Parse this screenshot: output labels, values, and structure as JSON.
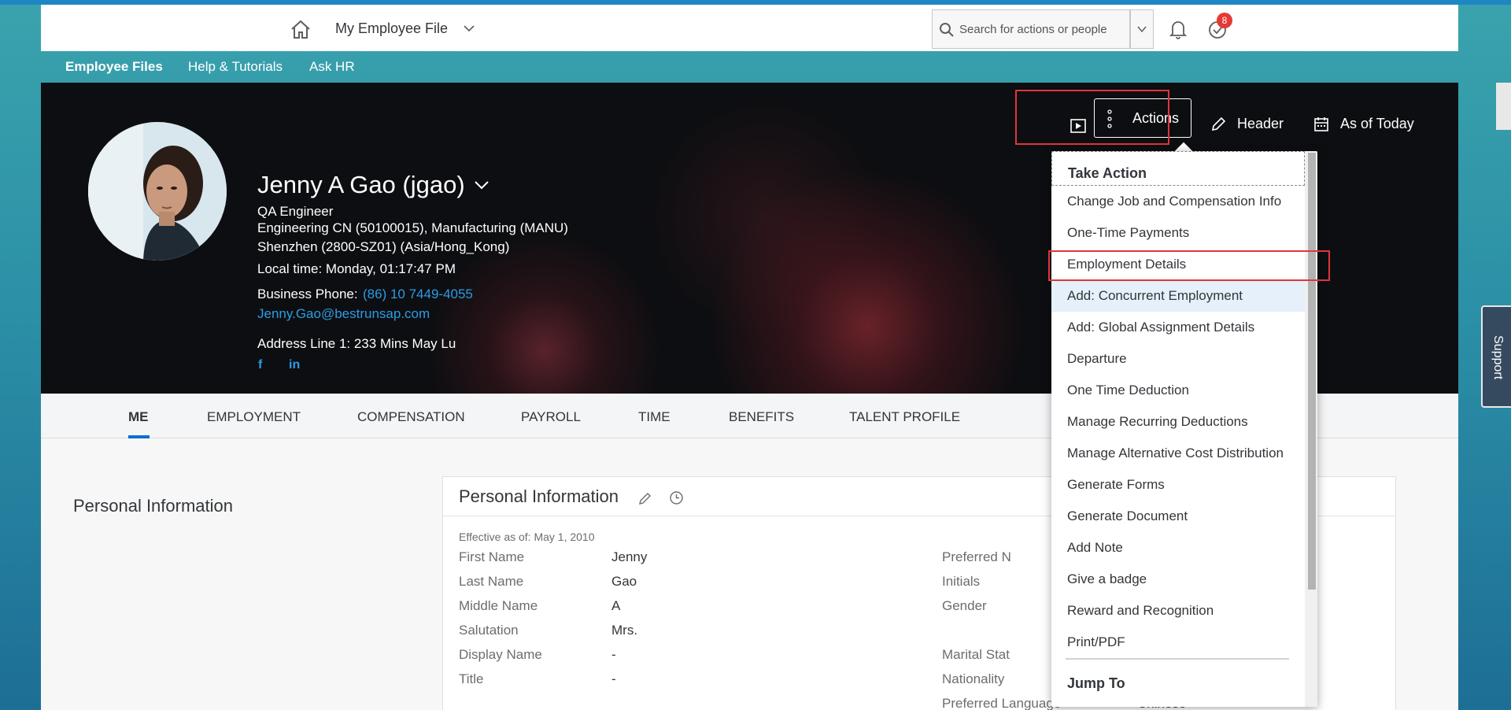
{
  "shell": {
    "title": "My Employee File",
    "search_placeholder": "Search for actions or people",
    "notification_count": "8"
  },
  "subnav": {
    "items": [
      "Employee Files",
      "Help & Tutorials",
      "Ask HR"
    ]
  },
  "header": {
    "name": "Jenny A Gao (jgao)",
    "job_title": "QA Engineer",
    "department": "Engineering CN (50100015), Manufacturing (MANU)",
    "location": "Shenzhen (2800-SZ01) (Asia/Hong_Kong)",
    "local_time": "Local time: Monday, 01:17:47 PM",
    "business_phone_label": "Business Phone:",
    "business_phone": "(86) 10 7449-4055",
    "email": "Jenny.Gao@bestrunsap.com",
    "address": "Address Line 1: 233 Mins May Lu",
    "social": [
      "f",
      "in"
    ],
    "actions_label": "Actions",
    "header_label": "Header",
    "as_of_label": "As of Today"
  },
  "tabs": [
    "ME",
    "EMPLOYMENT",
    "COMPENSATION",
    "PAYROLL",
    "TIME",
    "BENEFITS",
    "TALENT PROFILE"
  ],
  "content": {
    "section_label": "Personal Information",
    "card_title": "Personal Information",
    "effective": "Effective as of: May 1, 2010",
    "fields_left": [
      {
        "label": "First Name",
        "value": "Jenny"
      },
      {
        "label": "Last Name",
        "value": "Gao"
      },
      {
        "label": "Middle Name",
        "value": "A"
      },
      {
        "label": "Salutation",
        "value": "Mrs."
      },
      {
        "label": "Display Name",
        "value": "-"
      },
      {
        "label": "Title",
        "value": "-"
      }
    ],
    "fields_right": [
      {
        "label": "Preferred N",
        "value": ""
      },
      {
        "label": "Initials",
        "value": ""
      },
      {
        "label": "Gender",
        "value": ""
      },
      {
        "label": "Marital Stat",
        "value": ""
      },
      {
        "label": "Nationality",
        "value": ""
      },
      {
        "label": "Preferred Language",
        "value": "Chinese"
      }
    ]
  },
  "menu": {
    "take_action": "Take Action",
    "items": [
      "Change Job and Compensation Info",
      "One-Time Payments",
      "Employment Details",
      "Add: Concurrent Employment",
      "Add: Global Assignment Details",
      "Departure",
      "One Time Deduction",
      "Manage Recurring Deductions",
      "Manage Alternative Cost Distribution",
      "Generate Forms",
      "Generate Document",
      "Add Note",
      "Give a badge",
      "Reward and Recognition",
      "Print/PDF"
    ],
    "jump_to": "Jump To"
  },
  "support_label": "Support",
  "colors": {
    "accent": "#0a6ed1",
    "link": "#2b9ce5",
    "highlight": "#e0353b",
    "shell_bg": "#ffffff",
    "page_bg": "#2b8fa6"
  }
}
